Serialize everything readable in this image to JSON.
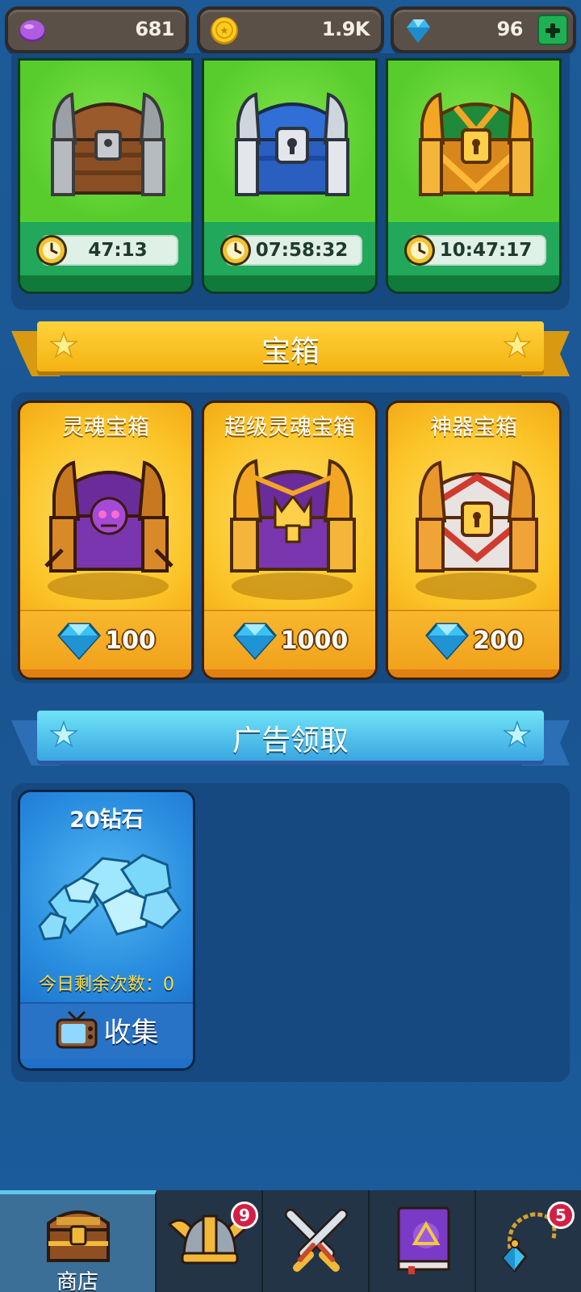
{
  "currency": {
    "purple_gems": "681",
    "gold": "1.9K",
    "diamonds": "96"
  },
  "timer_chests": [
    {
      "chest": "wooden-chest",
      "time": "47:13"
    },
    {
      "chest": "silver-chest",
      "time": "07:58:32"
    },
    {
      "chest": "golden-chest",
      "time": "10:47:17"
    }
  ],
  "sections": {
    "chests_title": "宝箱",
    "ads_title": "广告领取"
  },
  "shop_chests": [
    {
      "name": "灵魂宝箱",
      "price": "100"
    },
    {
      "name": "超级灵魂宝箱",
      "price": "1000"
    },
    {
      "name": "神器宝箱",
      "price": "200"
    }
  ],
  "ad_reward": {
    "name": "20钻石",
    "remaining": "今日剩余次数：0",
    "collect_label": "收集"
  },
  "nav": {
    "shop_label": "商店",
    "heroes_badge": "9",
    "accessories_badge": "5"
  },
  "colors": {
    "background": "#1a5592",
    "gold_banner": "#f4b313",
    "blue_banner": "#3aa6e1",
    "green_card": "#58cc2c",
    "orange_card": "#fbc428",
    "nav_active": "#3b6f98"
  }
}
